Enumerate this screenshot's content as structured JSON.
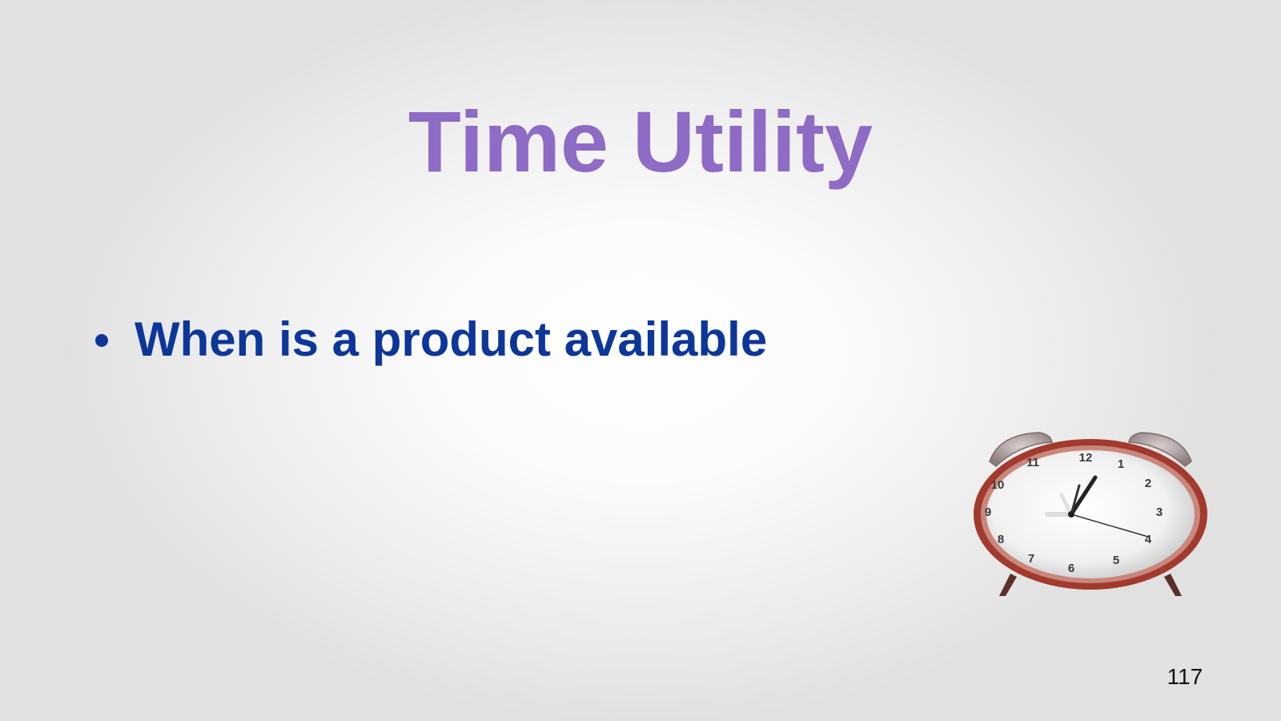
{
  "slide": {
    "title": "Time Utility",
    "bullets": [
      {
        "text": "When is a product available"
      }
    ],
    "page_number": "117",
    "image": {
      "icon": "alarm-clock-icon",
      "clock_numbers": [
        "12",
        "1",
        "2",
        "3",
        "4",
        "5",
        "6",
        "7",
        "8",
        "9",
        "10",
        "11"
      ]
    }
  },
  "colors": {
    "title": "#8e6bc4",
    "bullet_text": "#0d3699",
    "clock_rim": "#a23a2e",
    "page_number": "#111111"
  }
}
